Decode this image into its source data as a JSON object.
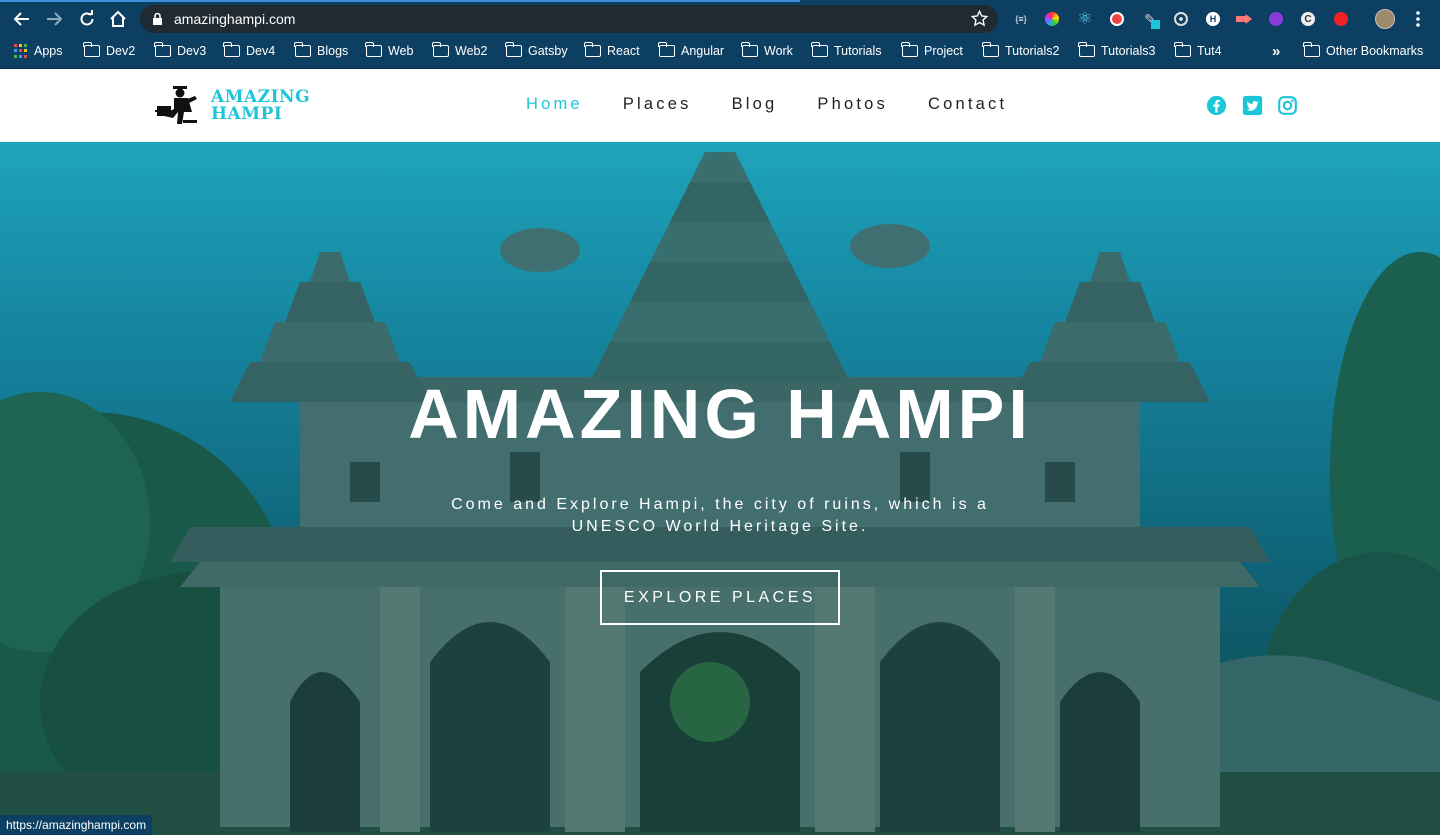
{
  "browser": {
    "url": "amazinghampi.com",
    "status_url": "https://amazinghampi.com",
    "bookmarks": [
      {
        "label": "Apps"
      },
      {
        "label": "Dev2"
      },
      {
        "label": "Dev3"
      },
      {
        "label": "Dev4"
      },
      {
        "label": "Blogs"
      },
      {
        "label": "Web"
      },
      {
        "label": "Web2"
      },
      {
        "label": "Gatsby"
      },
      {
        "label": "React"
      },
      {
        "label": "Angular"
      },
      {
        "label": "Work"
      },
      {
        "label": "Tutorials"
      },
      {
        "label": "Project"
      },
      {
        "label": "Tutorials2"
      },
      {
        "label": "Tutorials3"
      },
      {
        "label": "Tut4"
      }
    ],
    "overflow_label": "»",
    "other_bookmarks": "Other Bookmarks",
    "extension_icons": [
      "json-icon",
      "color-wheel-icon",
      "react-devtools-icon",
      "santa-icon",
      "pen-icon",
      "target-icon",
      "h-icon",
      "arrow-icon",
      "purple-circle-icon",
      "c-icon",
      "red-hand-icon"
    ]
  },
  "site": {
    "logo_line1": "AMAZING",
    "logo_line2": "HAMPI",
    "nav": [
      {
        "label": "Home",
        "active": true
      },
      {
        "label": "Places",
        "active": false
      },
      {
        "label": "Blog",
        "active": false
      },
      {
        "label": "Photos",
        "active": false
      },
      {
        "label": "Contact",
        "active": false
      }
    ],
    "social": [
      "facebook-icon",
      "twitter-icon",
      "instagram-icon"
    ],
    "accent_color": "#1cc6d8"
  },
  "hero": {
    "title": "AMAZING HAMPI",
    "subtitle_line1": "Come and Explore Hampi, the city of ruins, which is a",
    "subtitle_line2": "UNESCO World Heritage Site.",
    "cta": "EXPLORE PLACES"
  }
}
